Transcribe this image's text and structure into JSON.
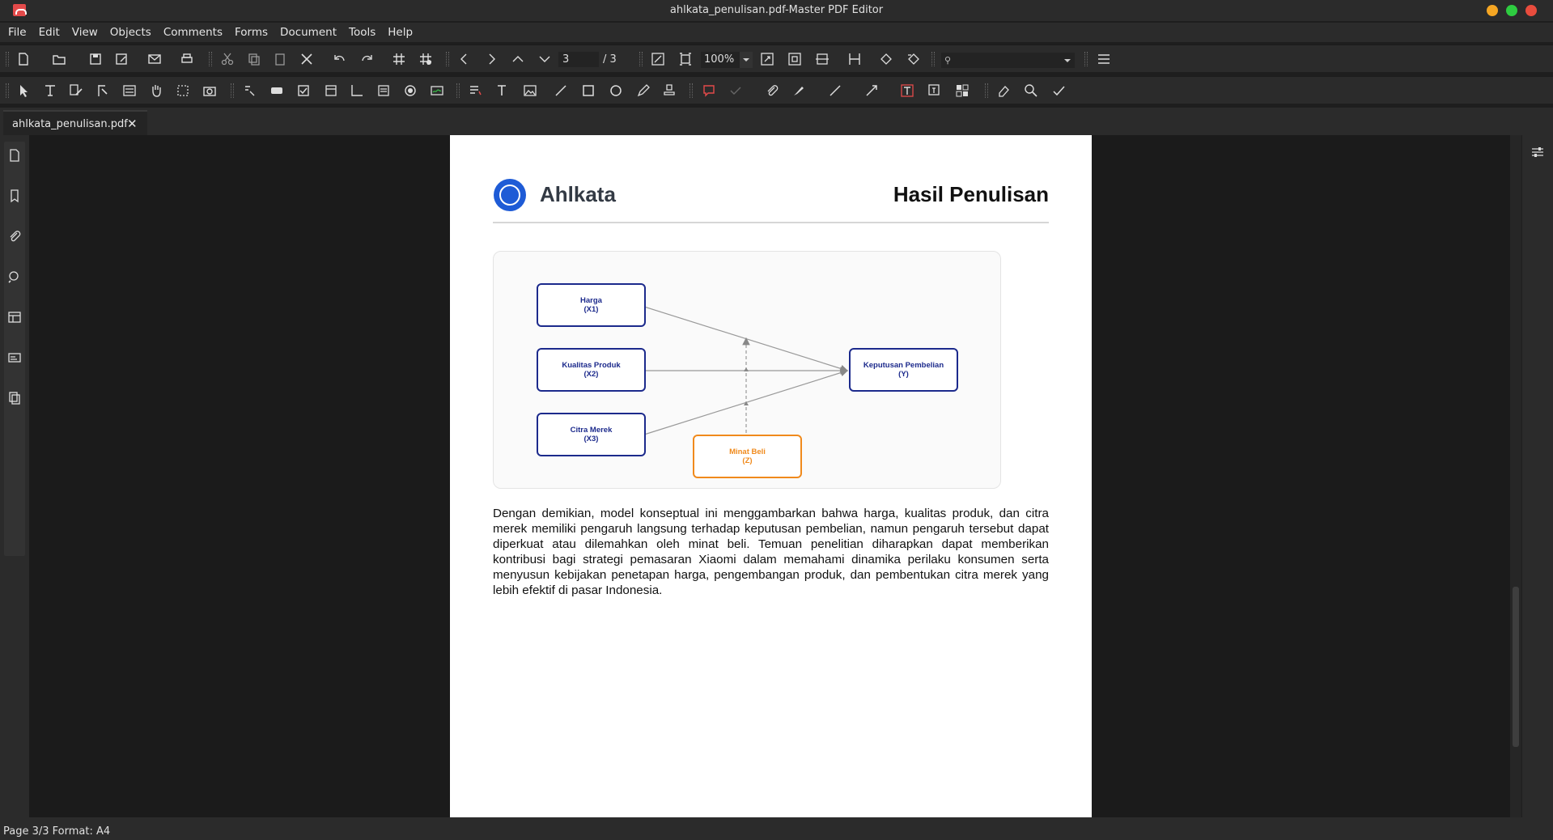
{
  "window": {
    "title": "ahlkata_penulisan.pdf-Master PDF Editor",
    "buttons": [
      {
        "name": "minimize-button",
        "color": "#f5a623"
      },
      {
        "name": "maximize-button",
        "color": "#2ecc40"
      },
      {
        "name": "close-button",
        "color": "#e84c3d"
      }
    ]
  },
  "menu": [
    "File",
    "Edit",
    "View",
    "Objects",
    "Comments",
    "Forms",
    "Document",
    "Tools",
    "Help"
  ],
  "toolbar": {
    "page_current": "3",
    "page_total": "/ 3",
    "zoom": "100%",
    "search_placeholder": ""
  },
  "tabs": [
    {
      "label": "ahlkata_penulisan.pdf",
      "close": "✕"
    }
  ],
  "document": {
    "brand": "Ahlkata",
    "heading": "Hasil Penulisan",
    "diagram": {
      "nodes": [
        {
          "id": "x1",
          "line1": "Harga",
          "line2": "(X1)",
          "color": "#1c2a8c"
        },
        {
          "id": "x2",
          "line1": "Kualitas Produk",
          "line2": "(X2)",
          "color": "#1c2a8c"
        },
        {
          "id": "x3",
          "line1": "Citra Merek",
          "line2": "(X3)",
          "color": "#1c2a8c"
        },
        {
          "id": "y",
          "line1": "Keputusan Pembelian",
          "line2": "(Y)",
          "color": "#1c2a8c"
        },
        {
          "id": "z",
          "line1": "Minat Beli",
          "line2": "(Z)",
          "color": "#f08a1c"
        }
      ]
    },
    "paragraph": "Dengan demikian, model konseptual ini menggambarkan bahwa harga, kualitas produk, dan citra merek memiliki pengaruh langsung terhadap keputusan pembelian, namun pengaruh tersebut dapat diperkuat atau dilemahkan oleh minat beli. Temuan penelitian diharapkan dapat memberikan kontribusi bagi strategi pemasaran Xiaomi dalam memahami dinamika perilaku konsumen serta menyusun kebijakan penetapan harga, pengembangan produk, dan pembentukan citra merek yang lebih efektif di pasar Indonesia."
  },
  "status": "Page 3/3 Format: A4"
}
